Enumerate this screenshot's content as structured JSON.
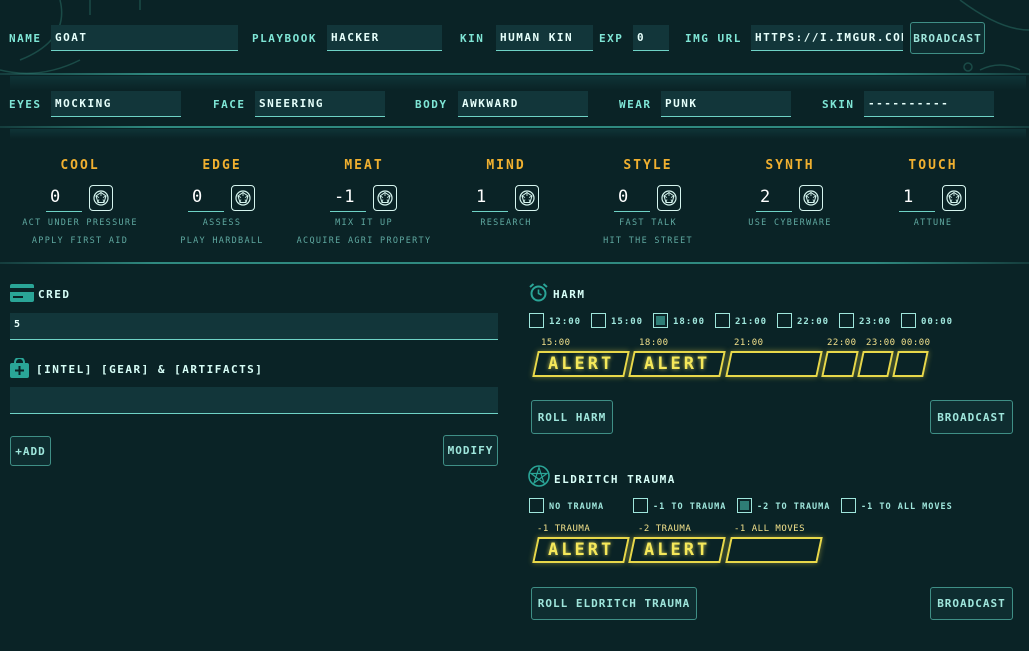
{
  "header": {
    "name_label": "NAME",
    "name_value": "GOAT",
    "playbook_label": "PLAYBOOK",
    "playbook_value": "HACKER",
    "kin_label": "KIN",
    "kin_value": "HUMAN KIN",
    "exp_label": "EXP",
    "exp_value": "0",
    "img_label": "IMG URL",
    "img_value": "HTTPS://I.IMGUR.COM",
    "broadcast_label": "BROADCAST"
  },
  "looks": {
    "eyes_label": "EYES",
    "eyes_value": "MOCKING",
    "face_label": "FACE",
    "face_value": "SNEERING",
    "body_label": "BODY",
    "body_value": "AWKWARD",
    "wear_label": "WEAR",
    "wear_value": "PUNK",
    "skin_label": "SKIN",
    "skin_value": "----------"
  },
  "stats": [
    {
      "name": "COOL",
      "value": "0",
      "moves": [
        "ACT UNDER PRESSURE",
        "APPLY FIRST AID"
      ]
    },
    {
      "name": "EDGE",
      "value": "0",
      "moves": [
        "ASSESS",
        "PLAY HARDBALL"
      ]
    },
    {
      "name": "MEAT",
      "value": "-1",
      "moves": [
        "MIX IT UP",
        "ACQUIRE AGRI PROPERTY"
      ]
    },
    {
      "name": "MIND",
      "value": "1",
      "moves": [
        "RESEARCH",
        ""
      ]
    },
    {
      "name": "STYLE",
      "value": "0",
      "moves": [
        "FAST TALK",
        "HIT THE STREET"
      ]
    },
    {
      "name": "SYNTH",
      "value": "2",
      "moves": [
        "USE CYBERWARE",
        ""
      ]
    },
    {
      "name": "TOUCH",
      "value": "1",
      "moves": [
        "ATTUNE",
        ""
      ]
    }
  ],
  "cred": {
    "title": "CRED",
    "value": "5"
  },
  "gear": {
    "title": "[INTEL] [GEAR] & [ARTIFACTS]",
    "value": "",
    "add_label": "+ADD",
    "modify_label": "MODIFY"
  },
  "harm": {
    "title": "HARM",
    "clocks": [
      {
        "label": "12:00",
        "checked": false
      },
      {
        "label": "15:00",
        "checked": false
      },
      {
        "label": "18:00",
        "checked": true
      },
      {
        "label": "21:00",
        "checked": false
      },
      {
        "label": "22:00",
        "checked": false
      },
      {
        "label": "23:00",
        "checked": false
      },
      {
        "label": "00:00",
        "checked": false
      }
    ],
    "slots": [
      {
        "time": "15:00",
        "text": "ALERT"
      },
      {
        "time": "18:00",
        "text": "ALERT"
      },
      {
        "time": "21:00",
        "text": ""
      },
      {
        "time": "22:00",
        "text": ""
      },
      {
        "time": "23:00",
        "text": ""
      },
      {
        "time": "00:00",
        "text": ""
      }
    ],
    "roll_label": "ROLL HARM",
    "broadcast_label": "BROADCAST"
  },
  "trauma": {
    "title": "ELDRITCH TRAUMA",
    "options": [
      {
        "label": "NO TRAUMA",
        "checked": false
      },
      {
        "label": "-1 TO TRAUMA",
        "checked": false
      },
      {
        "label": "-2 TO TRAUMA",
        "checked": true
      },
      {
        "label": "-1 TO ALL MOVES",
        "checked": false
      }
    ],
    "slots": [
      {
        "time": "-1 TRAUMA",
        "text": "ALERT"
      },
      {
        "time": "-2 TRAUMA",
        "text": "ALERT"
      },
      {
        "time": "-1 ALL MOVES",
        "text": ""
      }
    ],
    "roll_label": "ROLL ELDRITCH TRAUMA",
    "broadcast_label": "BROADCAST"
  },
  "colors": {
    "accent": "#7fe6d6",
    "stat": "#f0b030",
    "alert": "#f5e85a",
    "bg": "#0a2326"
  }
}
